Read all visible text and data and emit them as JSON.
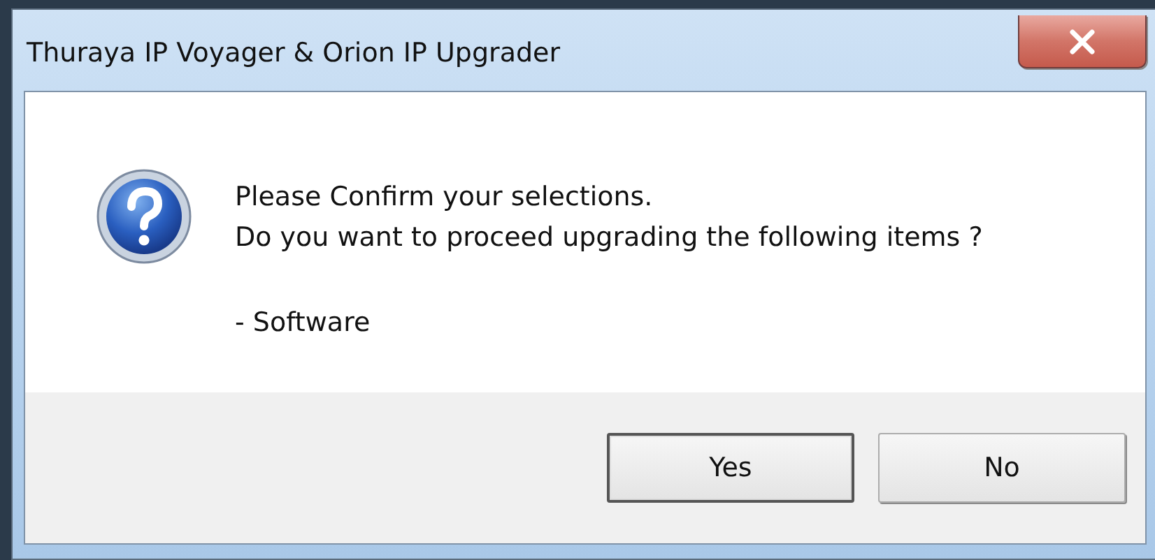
{
  "window": {
    "title": "Thuraya IP Voyager & Orion IP Upgrader"
  },
  "message": {
    "lines": [
      "Please Confirm your selections.",
      "Do you want to proceed upgrading the following items ?"
    ],
    "items": [
      "- Software"
    ]
  },
  "buttons": [
    {
      "label": "Yes",
      "default": true
    },
    {
      "label": "No",
      "default": false
    }
  ]
}
